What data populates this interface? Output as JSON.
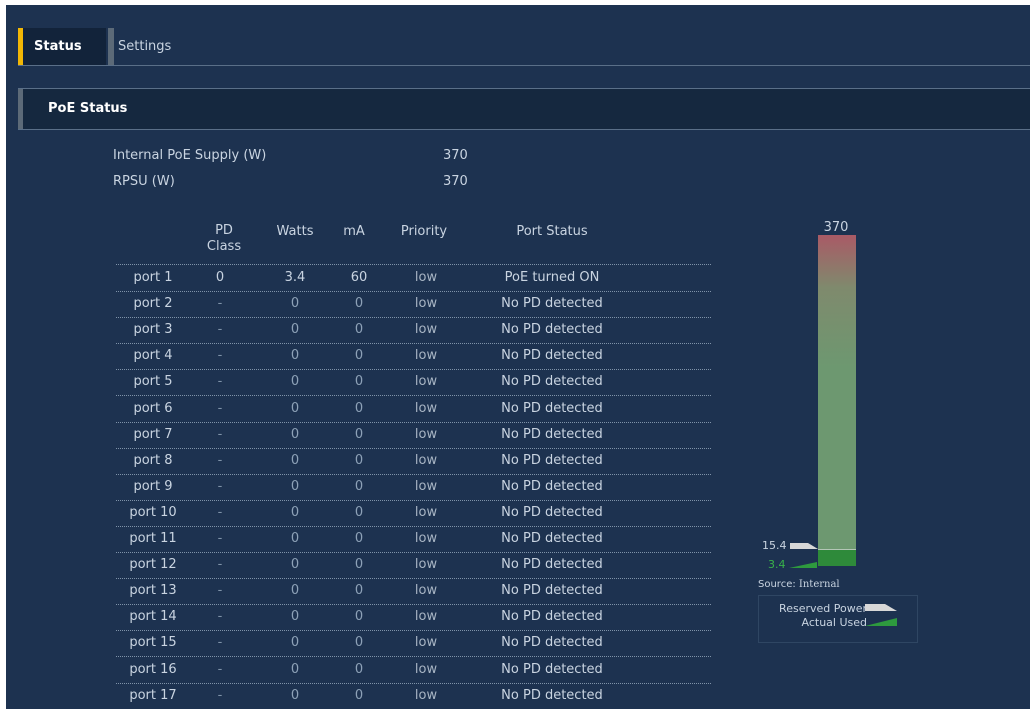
{
  "tabs": [
    {
      "label": "Status",
      "active": true
    },
    {
      "label": "Settings",
      "active": false
    }
  ],
  "section_title": "PoE Status",
  "supply": {
    "internal_label": "Internal PoE Supply (W)",
    "internal_value": "370",
    "rpsu_label": "RPSU (W)",
    "rpsu_value": "370"
  },
  "table": {
    "headers": [
      "PD Class",
      "Watts",
      "mA",
      "Priority",
      "Port Status"
    ],
    "rows": [
      {
        "port": "port 1",
        "class": "0",
        "watts": "3.4",
        "ma": "60",
        "priority": "low",
        "status": "PoE turned ON"
      },
      {
        "port": "port 2",
        "class": "-",
        "watts": "0",
        "ma": "0",
        "priority": "low",
        "status": "No PD detected"
      },
      {
        "port": "port 3",
        "class": "-",
        "watts": "0",
        "ma": "0",
        "priority": "low",
        "status": "No PD detected"
      },
      {
        "port": "port 4",
        "class": "-",
        "watts": "0",
        "ma": "0",
        "priority": "low",
        "status": "No PD detected"
      },
      {
        "port": "port 5",
        "class": "-",
        "watts": "0",
        "ma": "0",
        "priority": "low",
        "status": "No PD detected"
      },
      {
        "port": "port 6",
        "class": "-",
        "watts": "0",
        "ma": "0",
        "priority": "low",
        "status": "No PD detected"
      },
      {
        "port": "port 7",
        "class": "-",
        "watts": "0",
        "ma": "0",
        "priority": "low",
        "status": "No PD detected"
      },
      {
        "port": "port 8",
        "class": "-",
        "watts": "0",
        "ma": "0",
        "priority": "low",
        "status": "No PD detected"
      },
      {
        "port": "port 9",
        "class": "-",
        "watts": "0",
        "ma": "0",
        "priority": "low",
        "status": "No PD detected"
      },
      {
        "port": "port 10",
        "class": "-",
        "watts": "0",
        "ma": "0",
        "priority": "low",
        "status": "No PD detected"
      },
      {
        "port": "port 11",
        "class": "-",
        "watts": "0",
        "ma": "0",
        "priority": "low",
        "status": "No PD detected"
      },
      {
        "port": "port 12",
        "class": "-",
        "watts": "0",
        "ma": "0",
        "priority": "low",
        "status": "No PD detected"
      },
      {
        "port": "port 13",
        "class": "-",
        "watts": "0",
        "ma": "0",
        "priority": "low",
        "status": "No PD detected"
      },
      {
        "port": "port 14",
        "class": "-",
        "watts": "0",
        "ma": "0",
        "priority": "low",
        "status": "No PD detected"
      },
      {
        "port": "port 15",
        "class": "-",
        "watts": "0",
        "ma": "0",
        "priority": "low",
        "status": "No PD detected"
      },
      {
        "port": "port 16",
        "class": "-",
        "watts": "0",
        "ma": "0",
        "priority": "low",
        "status": "No PD detected"
      },
      {
        "port": "port 17",
        "class": "-",
        "watts": "0",
        "ma": "0",
        "priority": "low",
        "status": "No PD detected"
      }
    ]
  },
  "gauge": {
    "max_label": "370",
    "reserved_value": "15.4",
    "actual_value": "3.4",
    "source_label": "Source:",
    "source_value": "Internal",
    "legend_reserved": "Reserved Power",
    "legend_actual": "Actual Used"
  },
  "colors": {
    "background": "#1d3250",
    "tab_accent": "#f2b705",
    "text": "#c9d4e1",
    "actual_green": "#38b24a"
  }
}
